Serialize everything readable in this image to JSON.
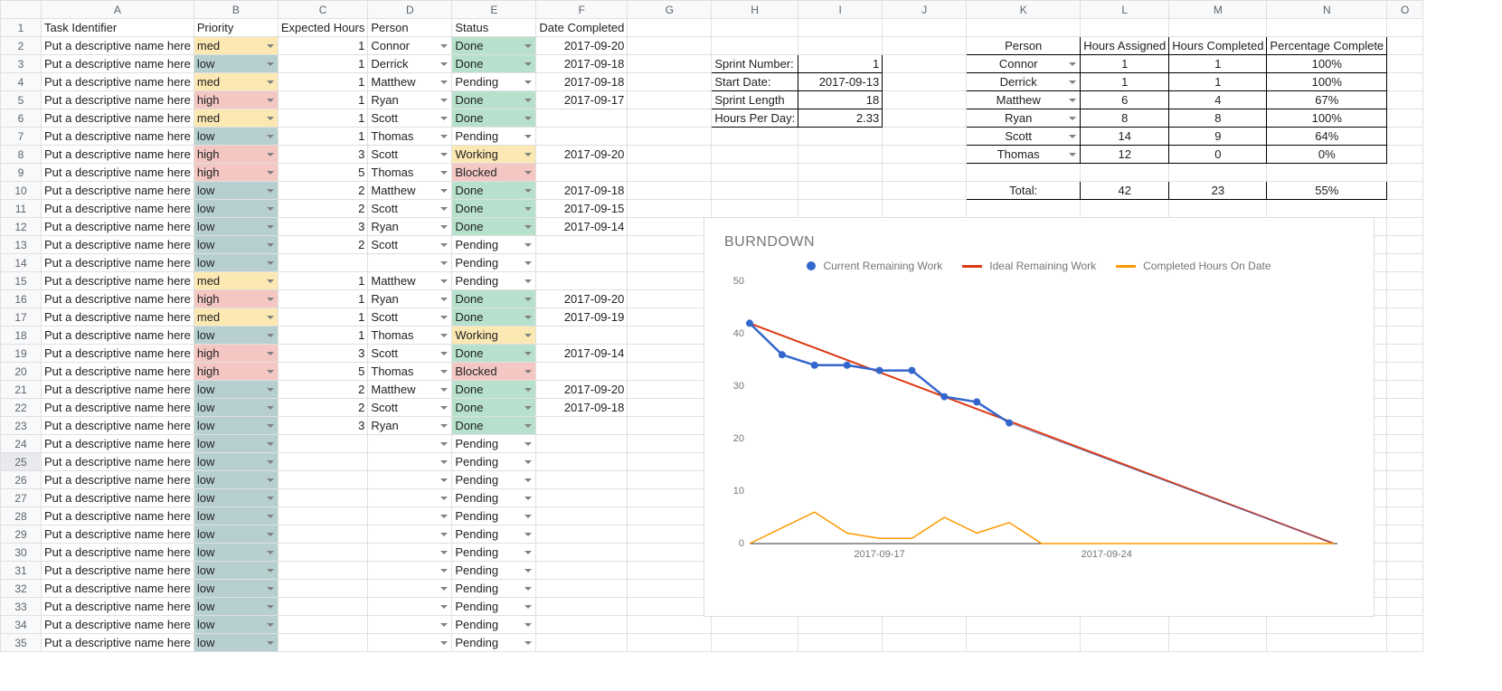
{
  "columns": [
    "",
    "A",
    "B",
    "C",
    "D",
    "E",
    "F",
    "G",
    "H",
    "I",
    "J",
    "K",
    "L",
    "M",
    "N",
    "O"
  ],
  "headers": {
    "A": "Task Identifier",
    "B": "Priority",
    "C": "Expected Hours",
    "D": "Person",
    "E": "Status",
    "F": "Date Completed"
  },
  "task_placeholder": "Put a descriptive name here",
  "rows": [
    {
      "pri": "med",
      "hrs": "1",
      "per": "Connor",
      "st": "Done",
      "dt": "2017-09-20"
    },
    {
      "pri": "low",
      "hrs": "1",
      "per": "Derrick",
      "st": "Done",
      "dt": "2017-09-18"
    },
    {
      "pri": "med",
      "hrs": "1",
      "per": "Matthew",
      "st": "Pending",
      "dt": "2017-09-18"
    },
    {
      "pri": "high",
      "hrs": "1",
      "per": "Ryan",
      "st": "Done",
      "dt": "2017-09-17"
    },
    {
      "pri": "med",
      "hrs": "1",
      "per": "Scott",
      "st": "Done",
      "dt": ""
    },
    {
      "pri": "low",
      "hrs": "1",
      "per": "Thomas",
      "st": "Pending",
      "dt": ""
    },
    {
      "pri": "high",
      "hrs": "3",
      "per": "Scott",
      "st": "Working",
      "dt": "2017-09-20"
    },
    {
      "pri": "high",
      "hrs": "5",
      "per": "Thomas",
      "st": "Blocked",
      "dt": ""
    },
    {
      "pri": "low",
      "hrs": "2",
      "per": "Matthew",
      "st": "Done",
      "dt": "2017-09-18"
    },
    {
      "pri": "low",
      "hrs": "2",
      "per": "Scott",
      "st": "Done",
      "dt": "2017-09-15"
    },
    {
      "pri": "low",
      "hrs": "3",
      "per": "Ryan",
      "st": "Done",
      "dt": "2017-09-14"
    },
    {
      "pri": "low",
      "hrs": "2",
      "per": "Scott",
      "st": "Pending",
      "dt": ""
    },
    {
      "pri": "low",
      "hrs": "",
      "per": "",
      "st": "Pending",
      "dt": ""
    },
    {
      "pri": "med",
      "hrs": "1",
      "per": "Matthew",
      "st": "Pending",
      "dt": ""
    },
    {
      "pri": "high",
      "hrs": "1",
      "per": "Ryan",
      "st": "Done",
      "dt": "2017-09-20"
    },
    {
      "pri": "med",
      "hrs": "1",
      "per": "Scott",
      "st": "Done",
      "dt": "2017-09-19"
    },
    {
      "pri": "low",
      "hrs": "1",
      "per": "Thomas",
      "st": "Working",
      "dt": ""
    },
    {
      "pri": "high",
      "hrs": "3",
      "per": "Scott",
      "st": "Done",
      "dt": "2017-09-14"
    },
    {
      "pri": "high",
      "hrs": "5",
      "per": "Thomas",
      "st": "Blocked",
      "dt": ""
    },
    {
      "pri": "low",
      "hrs": "2",
      "per": "Matthew",
      "st": "Done",
      "dt": "2017-09-20"
    },
    {
      "pri": "low",
      "hrs": "2",
      "per": "Scott",
      "st": "Done",
      "dt": "2017-09-18"
    },
    {
      "pri": "low",
      "hrs": "3",
      "per": "Ryan",
      "st": "Done",
      "dt": ""
    },
    {
      "pri": "low",
      "hrs": "",
      "per": "",
      "st": "Pending",
      "dt": ""
    },
    {
      "pri": "low",
      "hrs": "",
      "per": "",
      "st": "Pending",
      "dt": ""
    },
    {
      "pri": "low",
      "hrs": "",
      "per": "",
      "st": "Pending",
      "dt": ""
    },
    {
      "pri": "low",
      "hrs": "",
      "per": "",
      "st": "Pending",
      "dt": ""
    },
    {
      "pri": "low",
      "hrs": "",
      "per": "",
      "st": "Pending",
      "dt": ""
    },
    {
      "pri": "low",
      "hrs": "",
      "per": "",
      "st": "Pending",
      "dt": ""
    },
    {
      "pri": "low",
      "hrs": "",
      "per": "",
      "st": "Pending",
      "dt": ""
    },
    {
      "pri": "low",
      "hrs": "",
      "per": "",
      "st": "Pending",
      "dt": ""
    },
    {
      "pri": "low",
      "hrs": "",
      "per": "",
      "st": "Pending",
      "dt": ""
    },
    {
      "pri": "low",
      "hrs": "",
      "per": "",
      "st": "Pending",
      "dt": ""
    },
    {
      "pri": "low",
      "hrs": "",
      "per": "",
      "st": "Pending",
      "dt": ""
    },
    {
      "pri": "low",
      "hrs": "",
      "per": "",
      "st": "Pending",
      "dt": ""
    }
  ],
  "sprint": {
    "items": [
      {
        "label": "Sprint Number:",
        "val": "1"
      },
      {
        "label": "Start Date:",
        "val": "2017-09-13"
      },
      {
        "label": "Sprint Length",
        "val": "18"
      },
      {
        "label": "Hours Per Day:",
        "val": "2.33"
      }
    ]
  },
  "persons": {
    "hdr": [
      "Person",
      "Hours Assigned",
      "Hours Completed",
      "Percentage Complete"
    ],
    "rows": [
      {
        "p": "Connor",
        "a": "1",
        "c": "1",
        "pc": "100%"
      },
      {
        "p": "Derrick",
        "a": "1",
        "c": "1",
        "pc": "100%"
      },
      {
        "p": "Matthew",
        "a": "6",
        "c": "4",
        "pc": "67%"
      },
      {
        "p": "Ryan",
        "a": "8",
        "c": "8",
        "pc": "100%"
      },
      {
        "p": "Scott",
        "a": "14",
        "c": "9",
        "pc": "64%"
      },
      {
        "p": "Thomas",
        "a": "12",
        "c": "0",
        "pc": "0%"
      }
    ],
    "total": {
      "label": "Total:",
      "a": "42",
      "c": "23",
      "pc": "55%"
    }
  },
  "chart_data": {
    "type": "line",
    "title": "BURNDOWN",
    "series": [
      {
        "name": "Current Remaining Work",
        "color": "#3366cc",
        "style": "points-line",
        "values": [
          42,
          36,
          34,
          34,
          33,
          33,
          28,
          27,
          23
        ]
      },
      {
        "name": "Ideal Remaining Work",
        "color": "#dc3912",
        "style": "line",
        "values": [
          42,
          0
        ],
        "x_end": 18
      },
      {
        "name": "Completed Hours On Date",
        "color": "#ff9900",
        "style": "line",
        "values": [
          0,
          3,
          6,
          2,
          1,
          1,
          5,
          2,
          4,
          0,
          0,
          0,
          0,
          0,
          0,
          0,
          0,
          0,
          0
        ]
      }
    ],
    "xlabel": "",
    "ylabel": "",
    "yticks": [
      0,
      10,
      20,
      30,
      40,
      50
    ],
    "xticks": [
      "2017-09-17",
      "2017-09-24"
    ],
    "x_span": 18,
    "ylim": [
      0,
      50
    ]
  }
}
